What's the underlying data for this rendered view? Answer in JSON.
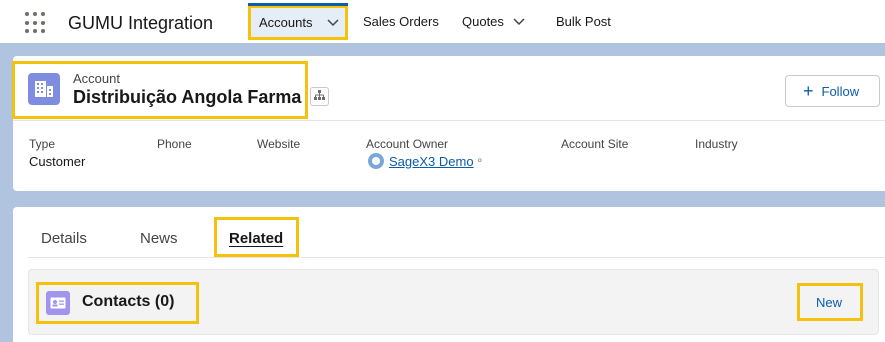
{
  "app": {
    "name": "GUMU Integration"
  },
  "nav": {
    "accounts": "Accounts",
    "sales_orders": "Sales Orders",
    "quotes": "Quotes",
    "bulk_post": "Bulk Post"
  },
  "record": {
    "object_label": "Account",
    "name": "Distribuição Angola Farma",
    "follow_label": "Follow"
  },
  "fields": {
    "type_label": "Type",
    "type_value": "Customer",
    "phone_label": "Phone",
    "website_label": "Website",
    "owner_label": "Account Owner",
    "owner_value": "SageX3 Demo",
    "site_label": "Account Site",
    "industry_label": "Industry"
  },
  "tabs": {
    "details": "Details",
    "news": "News",
    "related": "Related"
  },
  "related": {
    "contacts_title": "Contacts (0)",
    "new_label": "New"
  },
  "colors": {
    "highlight": "#f4c20d",
    "brand": "#0b5cab",
    "account_icon": "#7f8de1",
    "contact_icon": "#a094ed"
  },
  "icons": [
    "app-launcher-icon",
    "chevron-down-icon",
    "account-icon",
    "hierarchy-icon",
    "plus-icon",
    "avatar-icon",
    "change-owner-icon",
    "contact-card-icon"
  ]
}
